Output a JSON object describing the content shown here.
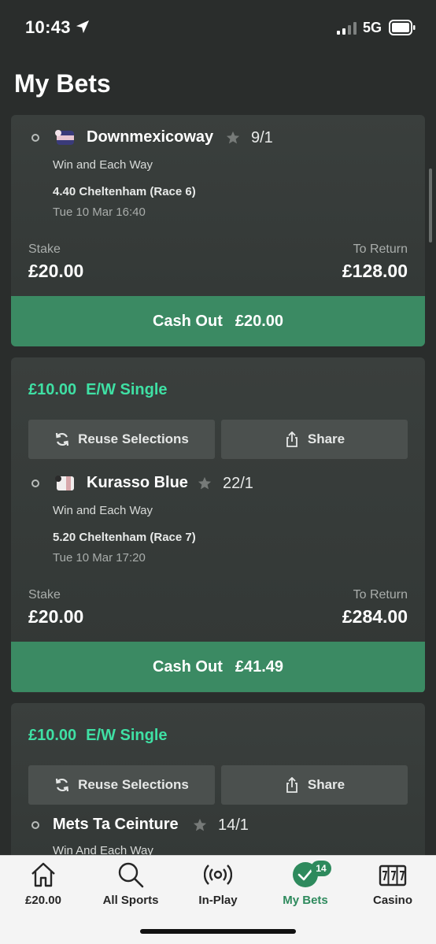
{
  "status_bar": {
    "time": "10:43",
    "network": "5G"
  },
  "page_title": "My Bets",
  "bets": [
    {
      "horse": "Downmexicoway",
      "odds": "9/1",
      "bet_type": "Win and Each Way",
      "race": "4.40 Cheltenham (Race 6)",
      "race_time": "Tue 10 Mar 16:40",
      "stake_label": "Stake",
      "stake": "£20.00",
      "return_label": "To Return",
      "to_return": "£128.00",
      "cashout_label": "Cash Out",
      "cashout_amount": "£20.00"
    },
    {
      "amount": "£10.00",
      "type": "E/W Single",
      "reuse_label": "Reuse Selections",
      "share_label": "Share",
      "horse": "Kurasso Blue",
      "odds": "22/1",
      "bet_type": "Win and Each Way",
      "race": "5.20 Cheltenham (Race 7)",
      "race_time": "Tue 10 Mar 17:20",
      "stake_label": "Stake",
      "stake": "£20.00",
      "return_label": "To Return",
      "to_return": "£284.00",
      "cashout_label": "Cash Out",
      "cashout_amount": "£41.49"
    },
    {
      "amount": "£10.00",
      "type": "E/W Single",
      "reuse_label": "Reuse Selections",
      "share_label": "Share",
      "horse": "Mets Ta Ceinture",
      "odds": "14/1",
      "bet_type": "Win And Each Way"
    }
  ],
  "tabbar": {
    "items": [
      {
        "label": "£20.00",
        "icon": "home-icon"
      },
      {
        "label": "All Sports",
        "icon": "search-icon"
      },
      {
        "label": "In-Play",
        "icon": "broadcast-icon"
      },
      {
        "label": "My Bets",
        "icon": "check-circle-icon",
        "badge": "14",
        "active": true
      },
      {
        "label": "Casino",
        "icon": "slot-machine-icon"
      }
    ]
  },
  "colors": {
    "background": "#2a2d2c",
    "card": "#363b39",
    "accent_green": "#3fe0a4",
    "cashout_green": "#3b8a63",
    "tab_active": "#2e8a5d"
  }
}
